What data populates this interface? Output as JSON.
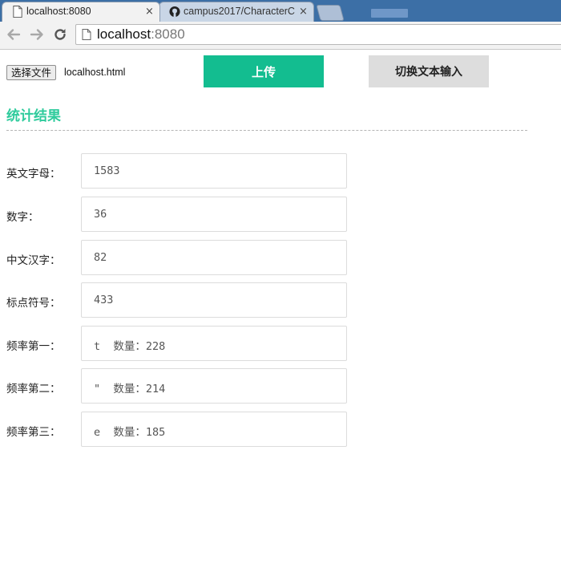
{
  "browser": {
    "tabs": [
      {
        "title": "localhost:8080",
        "close": "×"
      },
      {
        "title": "campus2017/CharacterC",
        "close": "×"
      }
    ],
    "address": {
      "host": "localhost",
      "port": ":8080"
    }
  },
  "form": {
    "file_button_label": "选择文件",
    "file_name": "localhost.html",
    "upload_label": "上传",
    "toggle_label": "切换文本输入"
  },
  "results": {
    "title": "统计结果",
    "rows": [
      {
        "label": "英文字母：",
        "value": "1583"
      },
      {
        "label": "数字：",
        "value": "36"
      },
      {
        "label": "中文汉字：",
        "value": "82"
      },
      {
        "label": "标点符号：",
        "value": "433"
      },
      {
        "label": "频率第一：",
        "value": "t  数量：228"
      },
      {
        "label": "频率第二：",
        "value": "\"  数量：214"
      },
      {
        "label": "频率第三：",
        "value": "e  数量：185"
      }
    ]
  },
  "colors": {
    "accent": "#13bd90",
    "title_green": "#2ecb9c",
    "chrome_blue": "#3c6fa6"
  },
  "icons": {
    "tab1": "page-icon",
    "tab2": "github-icon",
    "back": "back-arrow-icon",
    "forward": "forward-arrow-icon",
    "reload": "reload-icon",
    "omnibox": "page-icon"
  }
}
